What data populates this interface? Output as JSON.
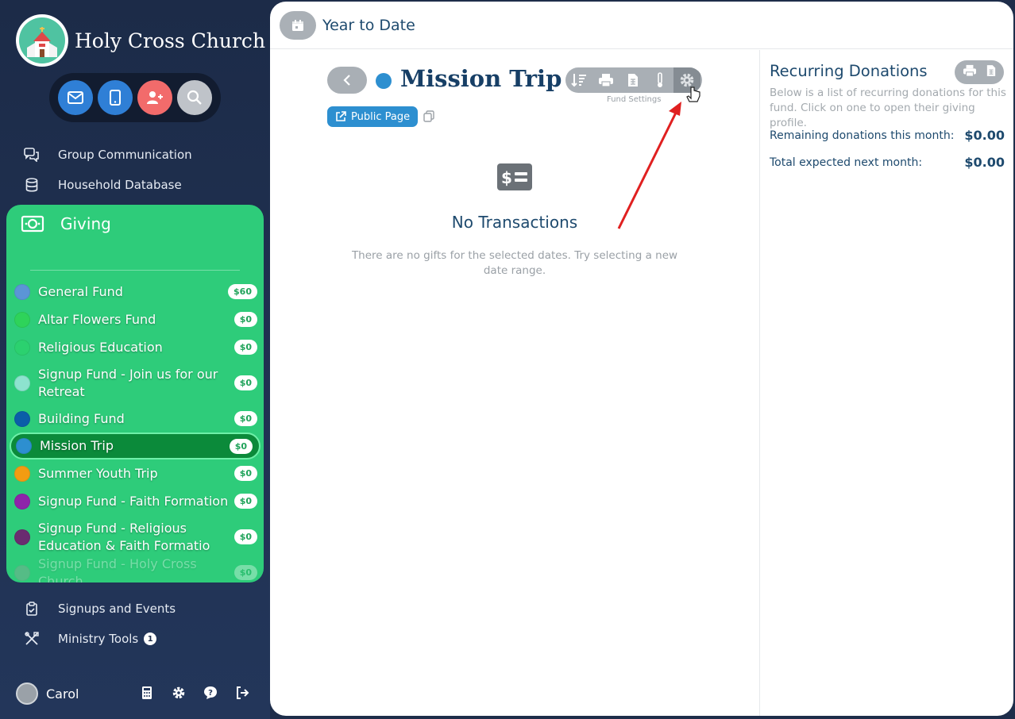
{
  "brand": {
    "name": "Holy Cross Church"
  },
  "nav": {
    "group_communication": "Group Communication",
    "household_database": "Household Database",
    "giving": "Giving",
    "signups_events": "Signups and Events",
    "ministry_tools": "Ministry Tools",
    "ministry_tools_badge": "1"
  },
  "funds": [
    {
      "name": "General Fund",
      "amount": "$60",
      "color": "#5b95d6"
    },
    {
      "name": "Altar Flowers Fund",
      "amount": "$0",
      "color": "#2ed35a"
    },
    {
      "name": "Religious Education",
      "amount": "$0",
      "color": "#2bd16f"
    },
    {
      "name": "Signup Fund - Join us for our Retreat",
      "amount": "$0",
      "color": "#8de3cf"
    },
    {
      "name": "Building Fund",
      "amount": "$0",
      "color": "#0b5ea8"
    },
    {
      "name": "Mission Trip",
      "amount": "$0",
      "color": "#2d8fd0"
    },
    {
      "name": "Summer Youth Trip",
      "amount": "$0",
      "color": "#f39c12"
    },
    {
      "name": "Signup Fund - Faith Formation",
      "amount": "$0",
      "color": "#8e24aa"
    },
    {
      "name": "Signup Fund - Religious Education & Faith Formatio",
      "amount": "$0",
      "color": "#6a2c70"
    },
    {
      "name": "Signup Fund - Holy Cross Church",
      "amount": "$0",
      "color": "#9e9e9e"
    }
  ],
  "user": {
    "name": "Carol"
  },
  "header": {
    "period": "Year to Date"
  },
  "fund_view": {
    "title": "Mission Trip",
    "title_color": "#2d8fd0",
    "public_page_label": "Public Page",
    "toolbar_caption": "Fund Settings",
    "empty_title": "No Transactions",
    "empty_text": "There are no gifts for the selected dates. Try selecting a new date range."
  },
  "recurring": {
    "title": "Recurring Donations",
    "description": "Below is a list of recurring donations for this fund. Click on one to open their giving profile.",
    "remaining_label": "Remaining donations this month:",
    "remaining_value": "$0.00",
    "expected_label": "Total expected next month:",
    "expected_value": "$0.00"
  },
  "colors": {
    "sidebar": "#1e2d4a",
    "giving": "#2ecc7a",
    "active_fund": "#0b8a3a",
    "accent": "#2d8fd0",
    "arrow": "#e02020"
  }
}
